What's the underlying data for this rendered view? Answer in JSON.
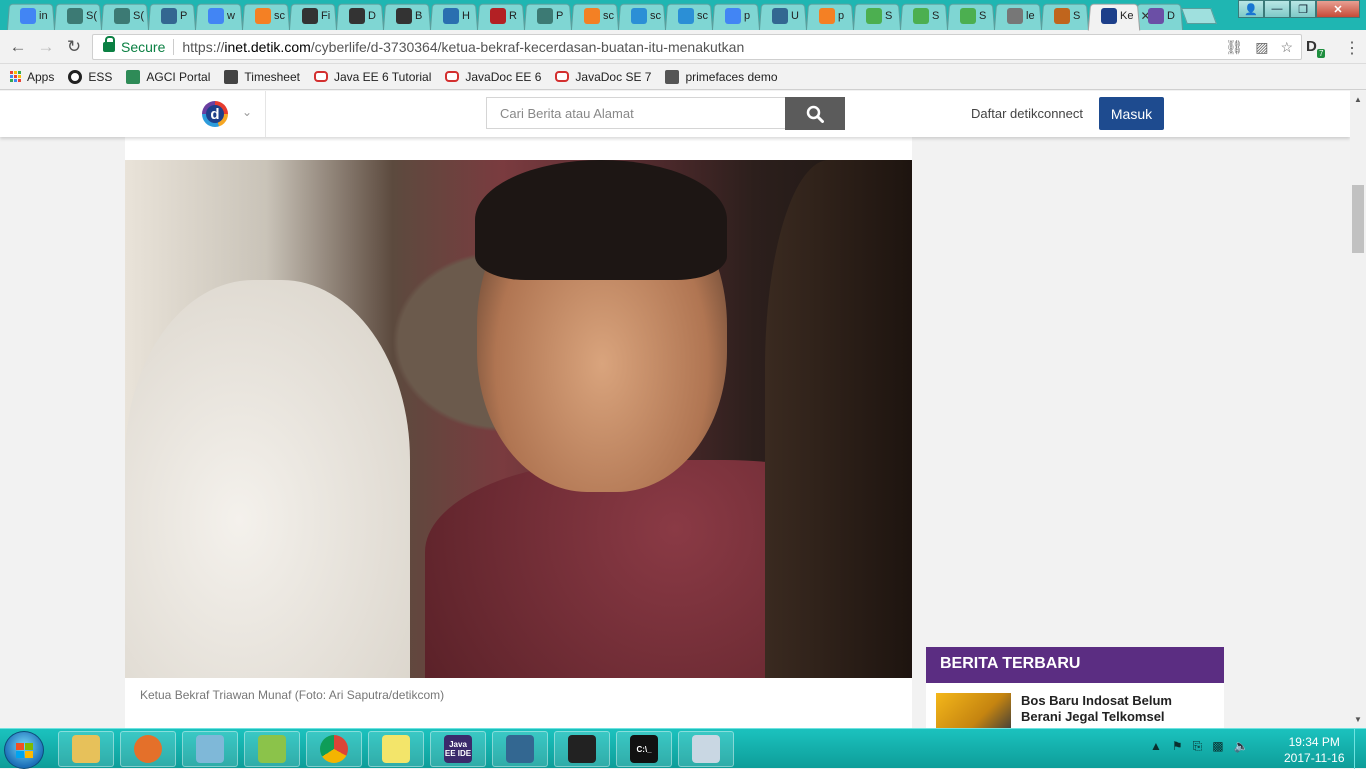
{
  "browser": {
    "tabs": [
      {
        "icon": "google-icon",
        "label": "in",
        "color": "#4285f4"
      },
      {
        "icon": "diamond-icon",
        "label": "S(",
        "color": "#3c7a74"
      },
      {
        "icon": "diamond-icon",
        "label": "S(",
        "color": "#3c7a74"
      },
      {
        "icon": "postgres-icon",
        "label": "P",
        "color": "#336791"
      },
      {
        "icon": "google-icon",
        "label": "w",
        "color": "#4285f4"
      },
      {
        "icon": "stackoverflow-icon",
        "label": "sc",
        "color": "#f48024"
      },
      {
        "icon": "wikipedia-icon",
        "label": "Fi",
        "color": "#333333"
      },
      {
        "icon": "wikipedia-icon",
        "label": "D",
        "color": "#333333"
      },
      {
        "icon": "wikipedia-icon",
        "label": "B",
        "color": "#333333"
      },
      {
        "icon": "h-icon",
        "label": "H",
        "color": "#2a6fb0"
      },
      {
        "icon": "redmine-icon",
        "label": "R",
        "color": "#b32024"
      },
      {
        "icon": "diamond-icon",
        "label": "P",
        "color": "#3c7a74"
      },
      {
        "icon": "stackoverflow-icon",
        "label": "sc",
        "color": "#f48024"
      },
      {
        "icon": "db-icon",
        "label": "sc",
        "color": "#2b8fd6"
      },
      {
        "icon": "db-icon",
        "label": "sc",
        "color": "#2b8fd6"
      },
      {
        "icon": "google-icon",
        "label": "p",
        "color": "#4285f4"
      },
      {
        "icon": "postgres-icon",
        "label": "U",
        "color": "#336791"
      },
      {
        "icon": "stackoverflow-icon",
        "label": "p",
        "color": "#f48024"
      },
      {
        "icon": "w3-icon",
        "label": "S",
        "color": "#4caf50"
      },
      {
        "icon": "w3-icon",
        "label": "S",
        "color": "#4caf50"
      },
      {
        "icon": "w3-icon",
        "label": "S",
        "color": "#4caf50"
      },
      {
        "icon": "page-icon",
        "label": "le",
        "color": "#777777"
      },
      {
        "icon": "swirl-icon",
        "label": "S",
        "color": "#c0651d"
      },
      {
        "icon": "detik-icon",
        "label": "Ke",
        "color": "#1d3f8a",
        "active": true
      },
      {
        "icon": "info-icon",
        "label": "D",
        "color": "#6b4fa6"
      }
    ],
    "address": {
      "secure_label": "Secure",
      "url_scheme": "https://",
      "url_host": "inet.detik.com",
      "url_path": "/cyberlife/d-3730364/ketua-bekraf-kecerdasan-buatan-itu-menakutkan"
    },
    "extension_badge": "7",
    "bookmarks": [
      {
        "icon": "apps-icon",
        "label": "Apps"
      },
      {
        "icon": "ess-icon",
        "label": "ESS"
      },
      {
        "icon": "agci-icon",
        "label": "AGCI Portal"
      },
      {
        "icon": "timesheet-icon",
        "label": "Timesheet"
      },
      {
        "icon": "oracle-icon",
        "label": "Java EE 6 Tutorial"
      },
      {
        "icon": "oracle-icon",
        "label": "JavaDoc EE 6"
      },
      {
        "icon": "oracle-icon",
        "label": "JavaDoc SE 7"
      },
      {
        "icon": "primefaces-icon",
        "label": "primefaces demo"
      }
    ]
  },
  "site": {
    "search_placeholder": "Cari Berita atau Alamat",
    "logo_letter": "d",
    "register_label": "Daftar detikconnect",
    "login_label": "Masuk",
    "photo_caption": "Ketua Bekraf Triawan Munaf (Foto: Ari Saputra/detikcom)",
    "latest": {
      "heading": "BERITA TERBARU",
      "items": [
        {
          "title": "Bos Baru Indosat Belum Berani Jegal Telkomsel"
        }
      ]
    }
  },
  "taskbar": {
    "apps": [
      {
        "icon": "explorer-icon",
        "label": ""
      },
      {
        "icon": "firefox-icon",
        "label": ""
      },
      {
        "icon": "notepad-icon",
        "label": ""
      },
      {
        "icon": "notepadpp-icon",
        "label": ""
      },
      {
        "icon": "chrome-icon",
        "label": ""
      },
      {
        "icon": "sticky-notes-icon",
        "label": ""
      },
      {
        "icon": "javaee-ide-icon",
        "label": "Java EE IDE"
      },
      {
        "icon": "postgres-icon",
        "label": ""
      },
      {
        "icon": "photo-viewer-icon",
        "label": ""
      },
      {
        "icon": "cmd-icon",
        "label": "C:\\_"
      },
      {
        "icon": "paint-icon",
        "label": ""
      }
    ],
    "time": "19:34 PM",
    "date": "2017-11-16"
  }
}
